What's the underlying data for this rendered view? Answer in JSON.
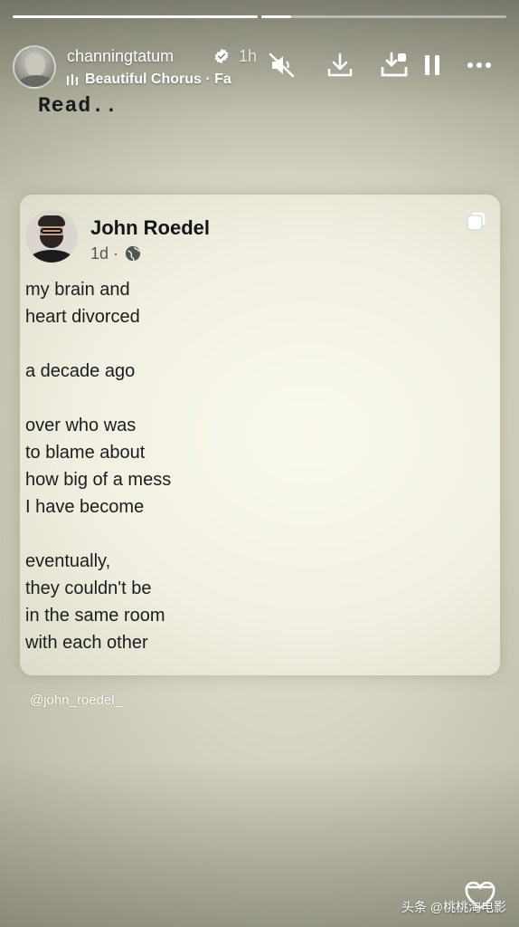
{
  "story": {
    "progress": [
      1.0,
      0.12
    ],
    "user": {
      "username": "channingtatum",
      "verified": true,
      "time_ago": "1h",
      "music": "Beautiful Chorus · Fa"
    },
    "controls": [
      "mute-icon",
      "download-icon",
      "save-icon",
      "pause-icon",
      "more-icon"
    ],
    "overlay_text": "Read..",
    "handle": "@john_roedel_"
  },
  "post": {
    "author": "John Roedel",
    "meta": "1d ·",
    "poem": [
      "my brain and",
      "heart divorced",
      "",
      "a decade ago",
      "",
      "over who was",
      "to blame about",
      "how big of a mess",
      "I have become",
      "",
      "eventually,",
      "they couldn't be",
      "in the same room",
      "with each other"
    ]
  },
  "watermark": "头条 @桃桃淘电影",
  "colors": {
    "background": "#d6d5c2",
    "card": "#f1f0e2",
    "text": "#1c1c1c"
  }
}
